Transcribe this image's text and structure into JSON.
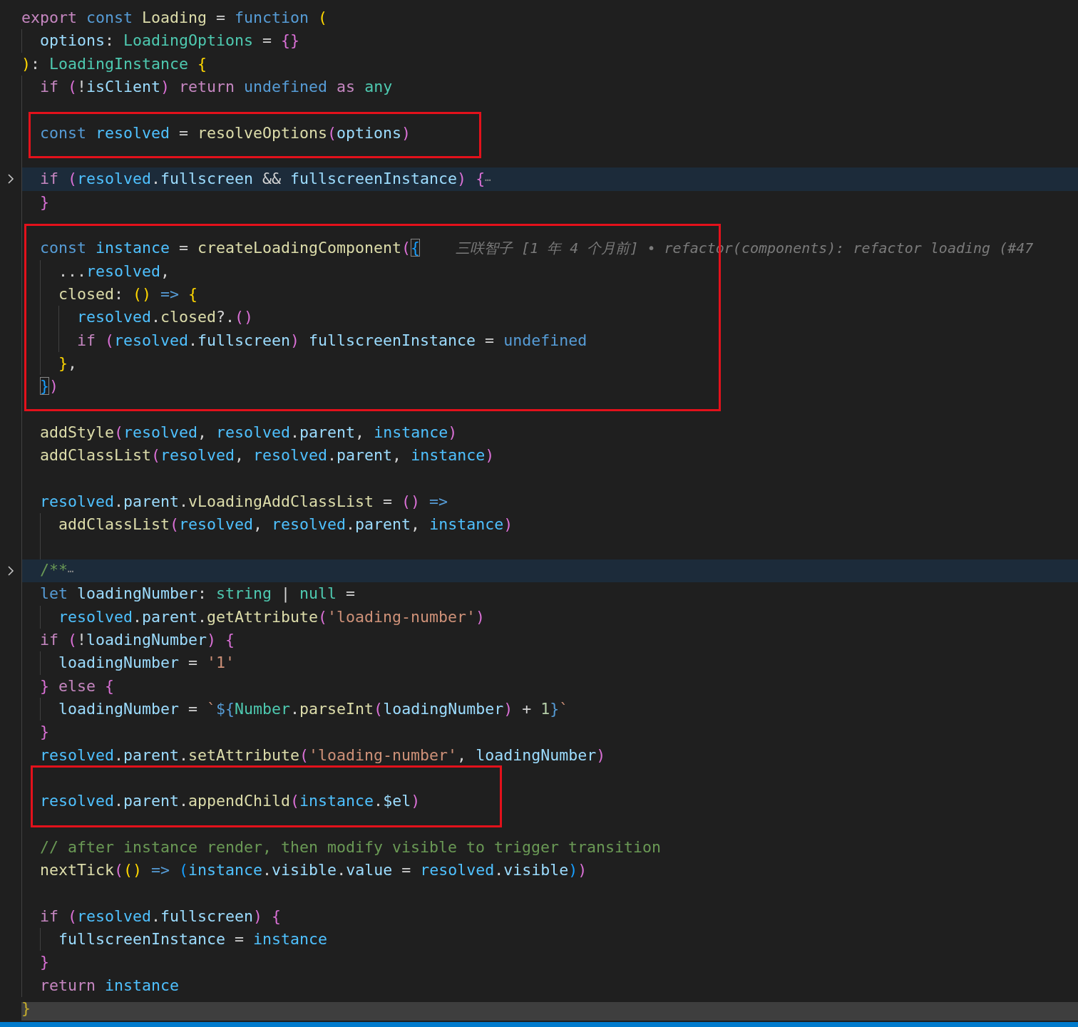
{
  "editor": {
    "lines": [
      {
        "kind": "line",
        "folded": false,
        "tokens": [
          {
            "text": "export",
            "kind": "kw"
          },
          {
            "text": " const",
            "kind": "st"
          },
          {
            "text": " Loading",
            "kind": "fn"
          },
          {
            "text": " = ",
            "kind": "op"
          },
          {
            "text": "function",
            "kind": "st"
          },
          {
            "text": " (",
            "kind": "b1"
          }
        ],
        "children": [
          {
            "kind": "line",
            "folded": false,
            "tokens": [
              {
                "text": "options",
                "kind": "pr"
              },
              {
                "text": ": ",
                "kind": "op"
              },
              {
                "text": "LoadingOptions",
                "kind": "ty"
              },
              {
                "text": " = ",
                "kind": "op"
              },
              {
                "text": "{}",
                "kind": "b2"
              }
            ]
          }
        ]
      },
      {
        "kind": "line",
        "folded": false,
        "tokens": [
          {
            "text": ")",
            "kind": "b1"
          },
          {
            "text": ": ",
            "kind": "op"
          },
          {
            "text": "LoadingInstance",
            "kind": "ty"
          },
          {
            "text": " {",
            "kind": "b1"
          }
        ],
        "children": [
          {
            "kind": "line",
            "folded": false,
            "tokens": [
              {
                "text": "if",
                "kind": "kw"
              },
              {
                "text": " (",
                "kind": "b2"
              },
              {
                "text": "!",
                "kind": "op"
              },
              {
                "text": "isClient",
                "kind": "pr"
              },
              {
                "text": ")",
                "kind": "b2"
              },
              {
                "text": " return",
                "kind": "kw"
              },
              {
                "text": " undefined",
                "kind": "st"
              },
              {
                "text": " as",
                "kind": "kw"
              },
              {
                "text": " any",
                "kind": "ty"
              }
            ]
          },
          {
            "kind": "line",
            "folded": false
          },
          {
            "kind": "boxed",
            "lines": [
              {
                "kind": "line",
                "folded": false,
                "tokens": [
                  {
                    "text": "const",
                    "kind": "st"
                  },
                  {
                    "text": " resolved",
                    "kind": "cv"
                  },
                  {
                    "text": " = ",
                    "kind": "op"
                  },
                  {
                    "text": "resolveOptions",
                    "kind": "fn"
                  },
                  {
                    "text": "(",
                    "kind": "b2"
                  },
                  {
                    "text": "options",
                    "kind": "pr"
                  },
                  {
                    "text": ")",
                    "kind": "b2"
                  }
                ]
              }
            ]
          },
          {
            "kind": "line",
            "folded": false
          },
          {
            "kind": "line",
            "folded": true,
            "tokens": [
              {
                "text": "if",
                "kind": "kw"
              },
              {
                "text": " (",
                "kind": "b2"
              },
              {
                "text": "resolved",
                "kind": "cv"
              },
              {
                "text": ".",
                "kind": "op"
              },
              {
                "text": "fullscreen",
                "kind": "pr"
              },
              {
                "text": " && ",
                "kind": "op"
              },
              {
                "text": "fullscreenInstance",
                "kind": "pr"
              },
              {
                "text": ")",
                "kind": "b2"
              },
              {
                "text": " {",
                "kind": "b2"
              },
              {
                "text": "⋯",
                "kind": "fold"
              }
            ]
          },
          {
            "kind": "line",
            "folded": false,
            "tokens": [
              {
                "text": "}",
                "kind": "b2"
              }
            ]
          },
          {
            "kind": "line",
            "folded": false
          },
          {
            "kind": "boxed",
            "lines": [
              {
                "kind": "line",
                "folded": false,
                "tokens": [
                  {
                    "text": "const",
                    "kind": "st"
                  },
                  {
                    "text": " instance",
                    "kind": "cv"
                  },
                  {
                    "text": " = ",
                    "kind": "op"
                  },
                  {
                    "text": "createLoadingComponent",
                    "kind": "fn"
                  },
                  {
                    "text": "(",
                    "kind": "b2"
                  },
                  {
                    "text": "{",
                    "kind": "b3match"
                  }
                ],
                "blame": "三咲智子 [1 年 4 个月前] • refactor(components): refactor loading (#47",
                "children": [
                  {
                    "kind": "line",
                    "folded": false,
                    "tokens": [
                      {
                        "text": "...",
                        "kind": "op"
                      },
                      {
                        "text": "resolved",
                        "kind": "cv"
                      },
                      {
                        "text": ",",
                        "kind": "op"
                      }
                    ]
                  },
                  {
                    "kind": "line",
                    "folded": false,
                    "tokens": [
                      {
                        "text": "closed",
                        "kind": "fn"
                      },
                      {
                        "text": ": ",
                        "kind": "op"
                      },
                      {
                        "text": "()",
                        "kind": "b1"
                      },
                      {
                        "text": " =>",
                        "kind": "st"
                      },
                      {
                        "text": " {",
                        "kind": "b1"
                      }
                    ],
                    "children": [
                      {
                        "kind": "line",
                        "folded": false,
                        "tokens": [
                          {
                            "text": "resolved",
                            "kind": "cv"
                          },
                          {
                            "text": ".",
                            "kind": "op"
                          },
                          {
                            "text": "closed",
                            "kind": "fn"
                          },
                          {
                            "text": "?.",
                            "kind": "op"
                          },
                          {
                            "text": "()",
                            "kind": "b2"
                          }
                        ]
                      },
                      {
                        "kind": "line",
                        "folded": false,
                        "tokens": [
                          {
                            "text": "if",
                            "kind": "kw"
                          },
                          {
                            "text": " (",
                            "kind": "b2"
                          },
                          {
                            "text": "resolved",
                            "kind": "cv"
                          },
                          {
                            "text": ".",
                            "kind": "op"
                          },
                          {
                            "text": "fullscreen",
                            "kind": "pr"
                          },
                          {
                            "text": ")",
                            "kind": "b2"
                          },
                          {
                            "text": " fullscreenInstance",
                            "kind": "pr"
                          },
                          {
                            "text": " = ",
                            "kind": "op"
                          },
                          {
                            "text": "undefined",
                            "kind": "st"
                          }
                        ]
                      }
                    ]
                  },
                  {
                    "kind": "line",
                    "folded": false,
                    "tokens": [
                      {
                        "text": "}",
                        "kind": "b1"
                      },
                      {
                        "text": ",",
                        "kind": "op"
                      }
                    ]
                  }
                ]
              },
              {
                "kind": "line",
                "folded": false,
                "tokens": [
                  {
                    "text": "}",
                    "kind": "b3match"
                  },
                  {
                    "text": ")",
                    "kind": "b2"
                  }
                ]
              }
            ]
          },
          {
            "kind": "line",
            "folded": false
          },
          {
            "kind": "line",
            "folded": false,
            "tokens": [
              {
                "text": "addStyle",
                "kind": "fn"
              },
              {
                "text": "(",
                "kind": "b2"
              },
              {
                "text": "resolved",
                "kind": "cv"
              },
              {
                "text": ", ",
                "kind": "op"
              },
              {
                "text": "resolved",
                "kind": "cv"
              },
              {
                "text": ".",
                "kind": "op"
              },
              {
                "text": "parent",
                "kind": "pr"
              },
              {
                "text": ", ",
                "kind": "op"
              },
              {
                "text": "instance",
                "kind": "cv"
              },
              {
                "text": ")",
                "kind": "b2"
              }
            ]
          },
          {
            "kind": "line",
            "folded": false,
            "tokens": [
              {
                "text": "addClassList",
                "kind": "fn"
              },
              {
                "text": "(",
                "kind": "b2"
              },
              {
                "text": "resolved",
                "kind": "cv"
              },
              {
                "text": ", ",
                "kind": "op"
              },
              {
                "text": "resolved",
                "kind": "cv"
              },
              {
                "text": ".",
                "kind": "op"
              },
              {
                "text": "parent",
                "kind": "pr"
              },
              {
                "text": ", ",
                "kind": "op"
              },
              {
                "text": "instance",
                "kind": "cv"
              },
              {
                "text": ")",
                "kind": "b2"
              }
            ]
          },
          {
            "kind": "line",
            "folded": false
          },
          {
            "kind": "line",
            "folded": false,
            "tokens": [
              {
                "text": "resolved",
                "kind": "cv"
              },
              {
                "text": ".",
                "kind": "op"
              },
              {
                "text": "parent",
                "kind": "pr"
              },
              {
                "text": ".",
                "kind": "op"
              },
              {
                "text": "vLoadingAddClassList",
                "kind": "fn"
              },
              {
                "text": " = ",
                "kind": "op"
              },
              {
                "text": "()",
                "kind": "b2"
              },
              {
                "text": " =>",
                "kind": "st"
              }
            ],
            "children": [
              {
                "kind": "line",
                "folded": false,
                "tokens": [
                  {
                    "text": "addClassList",
                    "kind": "fn"
                  },
                  {
                    "text": "(",
                    "kind": "b2"
                  },
                  {
                    "text": "resolved",
                    "kind": "cv"
                  },
                  {
                    "text": ", ",
                    "kind": "op"
                  },
                  {
                    "text": "resolved",
                    "kind": "cv"
                  },
                  {
                    "text": ".",
                    "kind": "op"
                  },
                  {
                    "text": "parent",
                    "kind": "pr"
                  },
                  {
                    "text": ", ",
                    "kind": "op"
                  },
                  {
                    "text": "instance",
                    "kind": "cv"
                  },
                  {
                    "text": ")",
                    "kind": "b2"
                  }
                ]
              },
              {
                "kind": "line",
                "folded": false
              }
            ]
          },
          {
            "kind": "line",
            "folded": true,
            "tokens": [
              {
                "text": "/**",
                "kind": "cm"
              },
              {
                "text": "⋯",
                "kind": "fold"
              }
            ]
          },
          {
            "kind": "line",
            "folded": false,
            "tokens": [
              {
                "text": "let",
                "kind": "st"
              },
              {
                "text": " loadingNumber",
                "kind": "pr"
              },
              {
                "text": ": ",
                "kind": "op"
              },
              {
                "text": "string",
                "kind": "ty"
              },
              {
                "text": " | ",
                "kind": "op"
              },
              {
                "text": "null",
                "kind": "ty"
              },
              {
                "text": " =",
                "kind": "op"
              }
            ],
            "children": [
              {
                "kind": "line",
                "folded": false,
                "tokens": [
                  {
                    "text": "resolved",
                    "kind": "cv"
                  },
                  {
                    "text": ".",
                    "kind": "op"
                  },
                  {
                    "text": "parent",
                    "kind": "pr"
                  },
                  {
                    "text": ".",
                    "kind": "op"
                  },
                  {
                    "text": "getAttribute",
                    "kind": "fn"
                  },
                  {
                    "text": "(",
                    "kind": "b2"
                  },
                  {
                    "text": "'loading-number'",
                    "kind": "str"
                  },
                  {
                    "text": ")",
                    "kind": "b2"
                  }
                ]
              }
            ]
          },
          {
            "kind": "line",
            "folded": false,
            "tokens": [
              {
                "text": "if",
                "kind": "kw"
              },
              {
                "text": " (",
                "kind": "b2"
              },
              {
                "text": "!",
                "kind": "op"
              },
              {
                "text": "loadingNumber",
                "kind": "pr"
              },
              {
                "text": ")",
                "kind": "b2"
              },
              {
                "text": " {",
                "kind": "b2"
              }
            ],
            "children": [
              {
                "kind": "line",
                "folded": false,
                "tokens": [
                  {
                    "text": "loadingNumber",
                    "kind": "pr"
                  },
                  {
                    "text": " = ",
                    "kind": "op"
                  },
                  {
                    "text": "'1'",
                    "kind": "str"
                  }
                ]
              }
            ]
          },
          {
            "kind": "line",
            "folded": false,
            "tokens": [
              {
                "text": "}",
                "kind": "b2"
              },
              {
                "text": " else",
                "kind": "kw"
              },
              {
                "text": " {",
                "kind": "b2"
              }
            ],
            "children": [
              {
                "kind": "line",
                "folded": false,
                "tokens": [
                  {
                    "text": "loadingNumber",
                    "kind": "pr"
                  },
                  {
                    "text": " = ",
                    "kind": "op"
                  },
                  {
                    "text": "`",
                    "kind": "str"
                  },
                  {
                    "text": "${",
                    "kind": "st"
                  },
                  {
                    "text": "Number",
                    "kind": "ty"
                  },
                  {
                    "text": ".",
                    "kind": "op"
                  },
                  {
                    "text": "parseInt",
                    "kind": "fn"
                  },
                  {
                    "text": "(",
                    "kind": "b2"
                  },
                  {
                    "text": "loadingNumber",
                    "kind": "pr"
                  },
                  {
                    "text": ")",
                    "kind": "b2"
                  },
                  {
                    "text": " + ",
                    "kind": "op"
                  },
                  {
                    "text": "1",
                    "kind": "num"
                  },
                  {
                    "text": "}",
                    "kind": "st"
                  },
                  {
                    "text": "`",
                    "kind": "str"
                  }
                ]
              }
            ]
          },
          {
            "kind": "line",
            "folded": false,
            "tokens": [
              {
                "text": "}",
                "kind": "b2"
              }
            ]
          },
          {
            "kind": "line",
            "folded": false,
            "tokens": [
              {
                "text": "resolved",
                "kind": "cv"
              },
              {
                "text": ".",
                "kind": "op"
              },
              {
                "text": "parent",
                "kind": "pr"
              },
              {
                "text": ".",
                "kind": "op"
              },
              {
                "text": "setAttribute",
                "kind": "fn"
              },
              {
                "text": "(",
                "kind": "b2"
              },
              {
                "text": "'loading-number'",
                "kind": "str"
              },
              {
                "text": ", ",
                "kind": "op"
              },
              {
                "text": "loadingNumber",
                "kind": "pr"
              },
              {
                "text": ")",
                "kind": "b2"
              }
            ]
          },
          {
            "kind": "line",
            "folded": false
          },
          {
            "kind": "boxed",
            "lines": [
              {
                "kind": "line",
                "folded": false,
                "tokens": [
                  {
                    "text": "resolved",
                    "kind": "cv"
                  },
                  {
                    "text": ".",
                    "kind": "op"
                  },
                  {
                    "text": "parent",
                    "kind": "pr"
                  },
                  {
                    "text": ".",
                    "kind": "op"
                  },
                  {
                    "text": "appendChild",
                    "kind": "fn"
                  },
                  {
                    "text": "(",
                    "kind": "b2"
                  },
                  {
                    "text": "instance",
                    "kind": "cv"
                  },
                  {
                    "text": ".",
                    "kind": "op"
                  },
                  {
                    "text": "$el",
                    "kind": "pr"
                  },
                  {
                    "text": ")",
                    "kind": "b2"
                  }
                ]
              }
            ]
          },
          {
            "kind": "line",
            "folded": false
          },
          {
            "kind": "line",
            "folded": false,
            "tokens": [
              {
                "text": "// after instance render, then modify visible to trigger transition",
                "kind": "cm"
              }
            ]
          },
          {
            "kind": "line",
            "folded": false,
            "tokens": [
              {
                "text": "nextTick",
                "kind": "fn"
              },
              {
                "text": "(",
                "kind": "b2"
              },
              {
                "text": "()",
                "kind": "b1"
              },
              {
                "text": " =>",
                "kind": "st"
              },
              {
                "text": " (",
                "kind": "b3"
              },
              {
                "text": "instance",
                "kind": "cv"
              },
              {
                "text": ".",
                "kind": "op"
              },
              {
                "text": "visible",
                "kind": "pr"
              },
              {
                "text": ".",
                "kind": "op"
              },
              {
                "text": "value",
                "kind": "pr"
              },
              {
                "text": " = ",
                "kind": "op"
              },
              {
                "text": "resolved",
                "kind": "cv"
              },
              {
                "text": ".",
                "kind": "op"
              },
              {
                "text": "visible",
                "kind": "pr"
              },
              {
                "text": ")",
                "kind": "b3"
              },
              {
                "text": ")",
                "kind": "b2"
              }
            ]
          },
          {
            "kind": "line",
            "folded": false
          },
          {
            "kind": "line",
            "folded": false,
            "tokens": [
              {
                "text": "if",
                "kind": "kw"
              },
              {
                "text": " (",
                "kind": "b2"
              },
              {
                "text": "resolved",
                "kind": "cv"
              },
              {
                "text": ".",
                "kind": "op"
              },
              {
                "text": "fullscreen",
                "kind": "pr"
              },
              {
                "text": ")",
                "kind": "b2"
              },
              {
                "text": " {",
                "kind": "b2"
              }
            ],
            "children": [
              {
                "kind": "line",
                "folded": false,
                "tokens": [
                  {
                    "text": "fullscreenInstance",
                    "kind": "pr"
                  },
                  {
                    "text": " = ",
                    "kind": "op"
                  },
                  {
                    "text": "instance",
                    "kind": "cv"
                  }
                ]
              }
            ]
          },
          {
            "kind": "line",
            "folded": false,
            "tokens": [
              {
                "text": "}",
                "kind": "b2"
              }
            ]
          },
          {
            "kind": "line",
            "folded": false,
            "tokens": [
              {
                "text": "return",
                "kind": "kw"
              },
              {
                "text": " instance",
                "kind": "cv"
              }
            ]
          }
        ]
      },
      {
        "kind": "line",
        "folded": false,
        "tokens": [
          {
            "text": "}",
            "kind": "b1"
          }
        ]
      }
    ]
  }
}
